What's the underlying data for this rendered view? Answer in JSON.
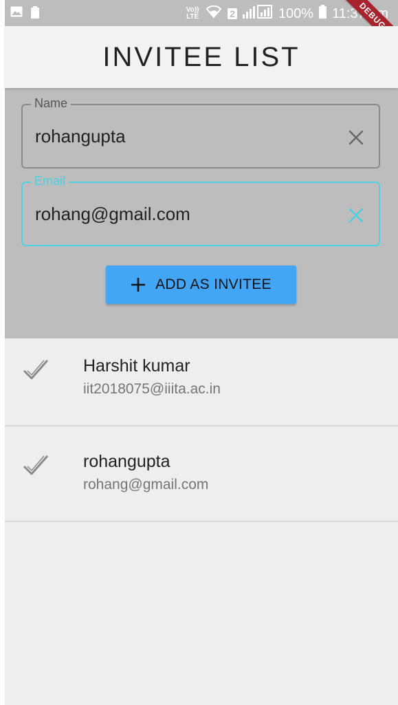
{
  "status_bar": {
    "volte": "Vo)) LTE",
    "sim": "2",
    "battery_percent": "100%",
    "time": "11:37 pm",
    "debug_label": "DEBUG"
  },
  "app_bar": {
    "title": "INVITEE LIST"
  },
  "form": {
    "name_field": {
      "label": "Name",
      "value": "rohangupta"
    },
    "email_field": {
      "label": "Email",
      "value": "rohang@gmail.com"
    },
    "add_button_label": "ADD AS INVITEE"
  },
  "invitees": [
    {
      "name": "Harshit kumar",
      "email": "iit2018075@iiita.ac.in"
    },
    {
      "name": "rohangupta",
      "email": "rohang@gmail.com"
    }
  ],
  "colors": {
    "accent": "#4dd0e1",
    "button": "#42a5f5",
    "debug_banner": "#a7232e"
  }
}
